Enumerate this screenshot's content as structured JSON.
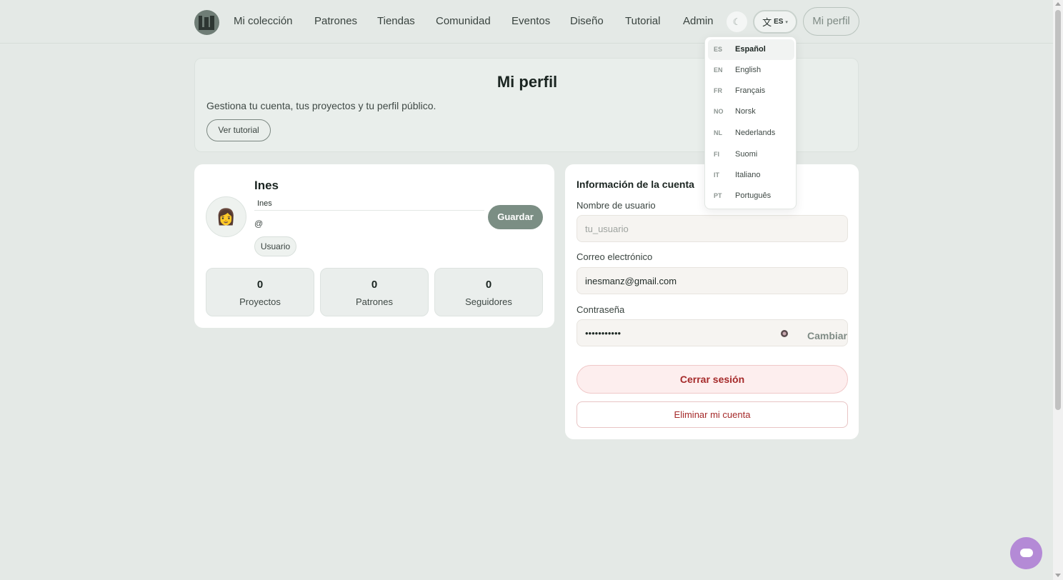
{
  "nav": {
    "items": [
      "Mi colección",
      "Patrones",
      "Tiendas",
      "Comunidad",
      "Eventos",
      "Diseño",
      "Tutorial",
      "Admin"
    ],
    "theme_icon": "☾",
    "lang_glyph": "文",
    "lang_code": "ES",
    "lang_caret": "▾",
    "profile_label": "Mi perfil"
  },
  "header": {
    "title": "Mi perfil",
    "subtitle": "Gestiona tu cuenta, tus proyectos y tu perfil público.",
    "tutorial_button": "Ver tutorial"
  },
  "profile": {
    "avatar_emoji": "👩",
    "display_name": "Ines",
    "name_input_value": "Ines",
    "handle": "@",
    "role": "Usuario",
    "save_button": "Guardar",
    "stats": [
      {
        "value": "0",
        "label": "Proyectos"
      },
      {
        "value": "0",
        "label": "Patrones"
      },
      {
        "value": "0",
        "label": "Seguidores"
      }
    ]
  },
  "account": {
    "title": "Información de la cuenta",
    "username_label": "Nombre de usuario",
    "username_placeholder": "tu_usuario",
    "email_label": "Correo electrónico",
    "email_value": "inesmanz@gmail.com",
    "password_label": "Contraseña",
    "password_value": "•••••••••••",
    "change_link": "Cambiar",
    "logout_button": "Cerrar sesión",
    "delete_button": "Eliminar mi cuenta"
  },
  "language_menu": [
    {
      "code": "ES",
      "name": "Español",
      "active": true
    },
    {
      "code": "EN",
      "name": "English"
    },
    {
      "code": "FR",
      "name": "Français"
    },
    {
      "code": "NO",
      "name": "Norsk"
    },
    {
      "code": "NL",
      "name": "Nederlands"
    },
    {
      "code": "FI",
      "name": "Suomi"
    },
    {
      "code": "IT",
      "name": "Italiano"
    },
    {
      "code": "PT",
      "name": "Português"
    }
  ],
  "colors": {
    "background": "#e4e9e6",
    "accent": "#7b8e84",
    "danger": "#a52a2a",
    "chat": "#b48ad6"
  }
}
